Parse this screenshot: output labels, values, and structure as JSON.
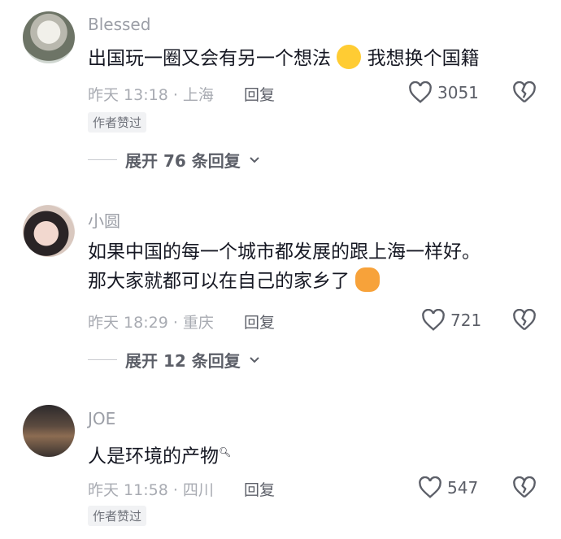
{
  "comments": [
    {
      "username": "Blessed",
      "text": "出国玩一圈又会有另一个想法",
      "text_after_emoji": "我想换个国籍",
      "meta": "昨天 13:18 · 上海",
      "reply": "回复",
      "likes": "3051",
      "badge": "作者赞过",
      "expand": "展开 76 条回复"
    },
    {
      "username": "小圆",
      "text_line1": "如果中国的每一个城市都发展的跟上海一样好。",
      "text_line2": "那大家就都可以在自己的家乡了",
      "meta": "昨天 18:29 · 重庆",
      "reply": "回复",
      "likes": "721",
      "expand": "展开 12 条回复"
    },
    {
      "username": "JOE",
      "text": "人是环境的产物",
      "meta": "昨天 11:58 · 四川",
      "reply": "回复",
      "likes": "547",
      "badge": "作者赞过"
    }
  ],
  "icons": {
    "like": "heart-outline-icon",
    "dislike": "broken-heart-icon",
    "expand": "chevron-down-icon",
    "search_link": "search-icon"
  },
  "colors": {
    "text": "#161823",
    "username": "#9b9ea6",
    "meta": "#a8abb2",
    "secondary": "#5c5f68",
    "badge_bg": "#f1f2f4"
  }
}
